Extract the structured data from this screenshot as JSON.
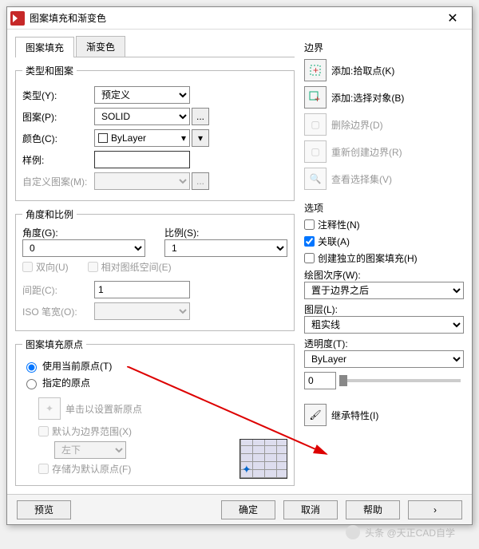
{
  "title": "图案填充和渐变色",
  "tabs": {
    "hatch": "图案填充",
    "gradient": "渐变色"
  },
  "typePattern": {
    "legend": "类型和图案",
    "type_lbl": "类型(Y):",
    "type_val": "预定义",
    "pattern_lbl": "图案(P):",
    "pattern_val": "SOLID",
    "color_lbl": "颜色(C):",
    "color_val": "ByLayer",
    "sample_lbl": "样例:",
    "custom_lbl": "自定义图案(M):"
  },
  "angleScale": {
    "legend": "角度和比例",
    "angle_lbl": "角度(G):",
    "angle_val": "0",
    "scale_lbl": "比例(S):",
    "scale_val": "1",
    "double": "双向(U)",
    "relpaper": "相对图纸空间(E)",
    "spacing_lbl": "间距(C):",
    "spacing_val": "1",
    "iso_lbl": "ISO 笔宽(O):"
  },
  "origin": {
    "legend": "图案填充原点",
    "use_current": "使用当前原点(T)",
    "specified": "指定的原点",
    "click_new": "单击以设置新原点",
    "default_ext": "默认为边界范围(X)",
    "pos": "左下",
    "store": "存储为默认原点(F)"
  },
  "boundary": {
    "header": "边界",
    "pick": "添加:拾取点(K)",
    "select": "添加:选择对象(B)",
    "remove": "删除边界(D)",
    "recreate": "重新创建边界(R)",
    "view": "查看选择集(V)"
  },
  "options": {
    "header": "选项",
    "annotative": "注释性(N)",
    "associative": "关联(A)",
    "separate": "创建独立的图案填充(H)",
    "draworder_lbl": "绘图次序(W):",
    "draworder_val": "置于边界之后",
    "layer_lbl": "图层(L):",
    "layer_val": "粗实线",
    "trans_lbl": "透明度(T):",
    "trans_mode": "ByLayer",
    "trans_val": "0",
    "inherit": "继承特性(I)"
  },
  "footer": {
    "preview": "预览",
    "ok": "确定",
    "cancel": "取消",
    "help": "帮助"
  },
  "watermark": {
    "src": "头条 @天正CAD自学"
  }
}
